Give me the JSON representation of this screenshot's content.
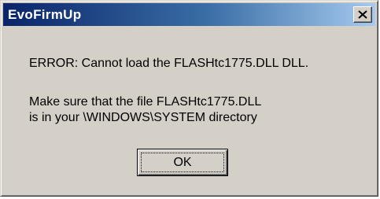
{
  "window": {
    "title": "EvoFirmUp",
    "close_icon": "close-x-icon"
  },
  "message": {
    "error_line": "ERROR: Cannot load the FLASHtc1775.DLL DLL.",
    "hint_line1": "Make sure that the file FLASHtc1775.DLL",
    "hint_line2": "is in your \\WINDOWS\\SYSTEM directory"
  },
  "buttons": {
    "ok_label": "OK"
  },
  "colors": {
    "title_gradient_start": "#0a246a",
    "title_gradient_end": "#a6caf0",
    "dialog_face": "#d4d0c8"
  }
}
